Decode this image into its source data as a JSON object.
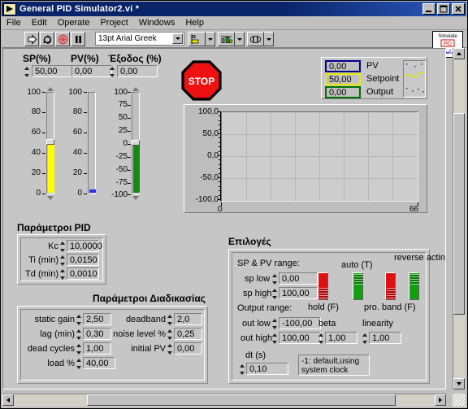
{
  "window": {
    "title": "General PID Simulator2.vi *",
    "icon": "labview-vi-icon",
    "minimize": "_",
    "maximize": "□",
    "close": "✕"
  },
  "menu": {
    "items": [
      "File",
      "Edit",
      "Operate",
      "Project",
      "Windows",
      "Help"
    ]
  },
  "toolbar": {
    "run": "run-arrow-icon",
    "run_continuously": "run-continuously-icon",
    "abort": "abort-execution-icon",
    "pause": "pause-icon",
    "font": "13pt Arial Greek",
    "align": "align-objects-icon",
    "distribute": "distribute-objects-icon",
    "reorder": "reorder-objects-icon",
    "vi_icon_text": "Simulate",
    "vi_icon_badge": "PID"
  },
  "stop_button": {
    "label": "STOP"
  },
  "sliders": [
    {
      "title": "SP(%)",
      "value": "50,00",
      "fill_color": "#ffff00",
      "min": 0,
      "max": 100,
      "knob_value": 50,
      "fill_from": 0,
      "fill_to": 50,
      "ticks": [
        "100",
        "80",
        "60",
        "40",
        "20",
        "0"
      ],
      "has_spinner": true
    },
    {
      "title": "PV(%)",
      "value": "0,00",
      "fill_color": "#2233ee",
      "min": 0,
      "max": 100,
      "knob_value": 0,
      "fill_from": 0,
      "fill_to": 1,
      "ticks": [
        "100",
        "80",
        "60",
        "40",
        "20",
        "0"
      ],
      "has_spinner": false
    },
    {
      "title": "Έξοδος (%)",
      "value": "0,00",
      "fill_color": "#138a13",
      "min": -100,
      "max": 100,
      "knob_value": 0,
      "fill_from": -100,
      "fill_to": 0,
      "ticks": [
        "100",
        "75",
        "50",
        "25",
        "0",
        "-25",
        "-50",
        "-75",
        "-100"
      ],
      "has_spinner": true
    }
  ],
  "legend": {
    "rows": [
      {
        "value": "0,00",
        "name": "PV",
        "color": "#00008b"
      },
      {
        "value": "50,00",
        "name": "Setpoint",
        "color": "#e8e800"
      },
      {
        "value": "0,00",
        "name": "Output",
        "color": "#007000"
      }
    ]
  },
  "chart_data": {
    "type": "line",
    "title": "",
    "xlabel": "",
    "ylabel": "",
    "ylim": [
      -100,
      100
    ],
    "xlim": [
      0,
      66
    ],
    "ytick_labels": [
      "100,0",
      "50,0",
      "0,0",
      "-50,0",
      "-100,0"
    ],
    "ytick_values": [
      100,
      50,
      0,
      -50,
      -100
    ],
    "xtick_labels": [
      "0",
      "66"
    ],
    "xtick_values": [
      0,
      66
    ],
    "grid": true,
    "legend_position": "top-right",
    "series": [
      {
        "name": "PV",
        "color": "#00008b",
        "x": [],
        "values": []
      },
      {
        "name": "Setpoint",
        "color": "#e8e800",
        "x": [],
        "values": []
      },
      {
        "name": "Output",
        "color": "#007000",
        "x": [],
        "values": []
      }
    ]
  },
  "pid_params": {
    "title": "Παράμετροι PID",
    "rows": [
      {
        "label": "Kc",
        "value": "10,0000"
      },
      {
        "label": "Ti (min)",
        "value": "0,0150"
      },
      {
        "label": "Td (min)",
        "value": "0,0010"
      }
    ]
  },
  "process_params": {
    "title": "Παράμετροι Διαδικασίας",
    "left": [
      {
        "label": "static gain",
        "value": "2,50"
      },
      {
        "label": "lag (min)",
        "value": "0,30"
      },
      {
        "label": "dead cycles",
        "value": "1,00"
      },
      {
        "label": "load %",
        "value": "40,00"
      }
    ],
    "right": [
      {
        "label": "deadband",
        "value": "2,0"
      },
      {
        "label": "noise level %",
        "value": "0,25"
      },
      {
        "label": "initial PV",
        "value": "0,00"
      }
    ]
  },
  "options": {
    "title": "Επιλογές",
    "sp_pv_range_label": "SP & PV range:",
    "output_range_label": "Output range:",
    "fields": [
      {
        "label": "sp low",
        "value": "0,00"
      },
      {
        "label": "sp high",
        "value": "100,00"
      },
      {
        "label": "out low",
        "value": "-100,00"
      },
      {
        "label": "out high",
        "value": "100,00"
      }
    ],
    "switches": [
      {
        "label": "hold (F)",
        "state": "F",
        "color": "#e01010",
        "label_pos": "below"
      },
      {
        "label": "auto (T)",
        "state": "T",
        "color": "#10a010",
        "label_pos": "above"
      },
      {
        "label": "pro. band (F)",
        "state": "F",
        "color": "#e01010",
        "label_pos": "below"
      },
      {
        "label": "reverse acting (T)",
        "state": "T",
        "color": "#10a010",
        "label_pos": "above"
      }
    ],
    "beta": {
      "label": "beta",
      "value": "1,00"
    },
    "linearity": {
      "label": "linearity",
      "value": "1,00"
    },
    "dt": {
      "label": "dt (s)",
      "value": "0,10"
    },
    "dt_note": "-1: default,using system clock"
  }
}
